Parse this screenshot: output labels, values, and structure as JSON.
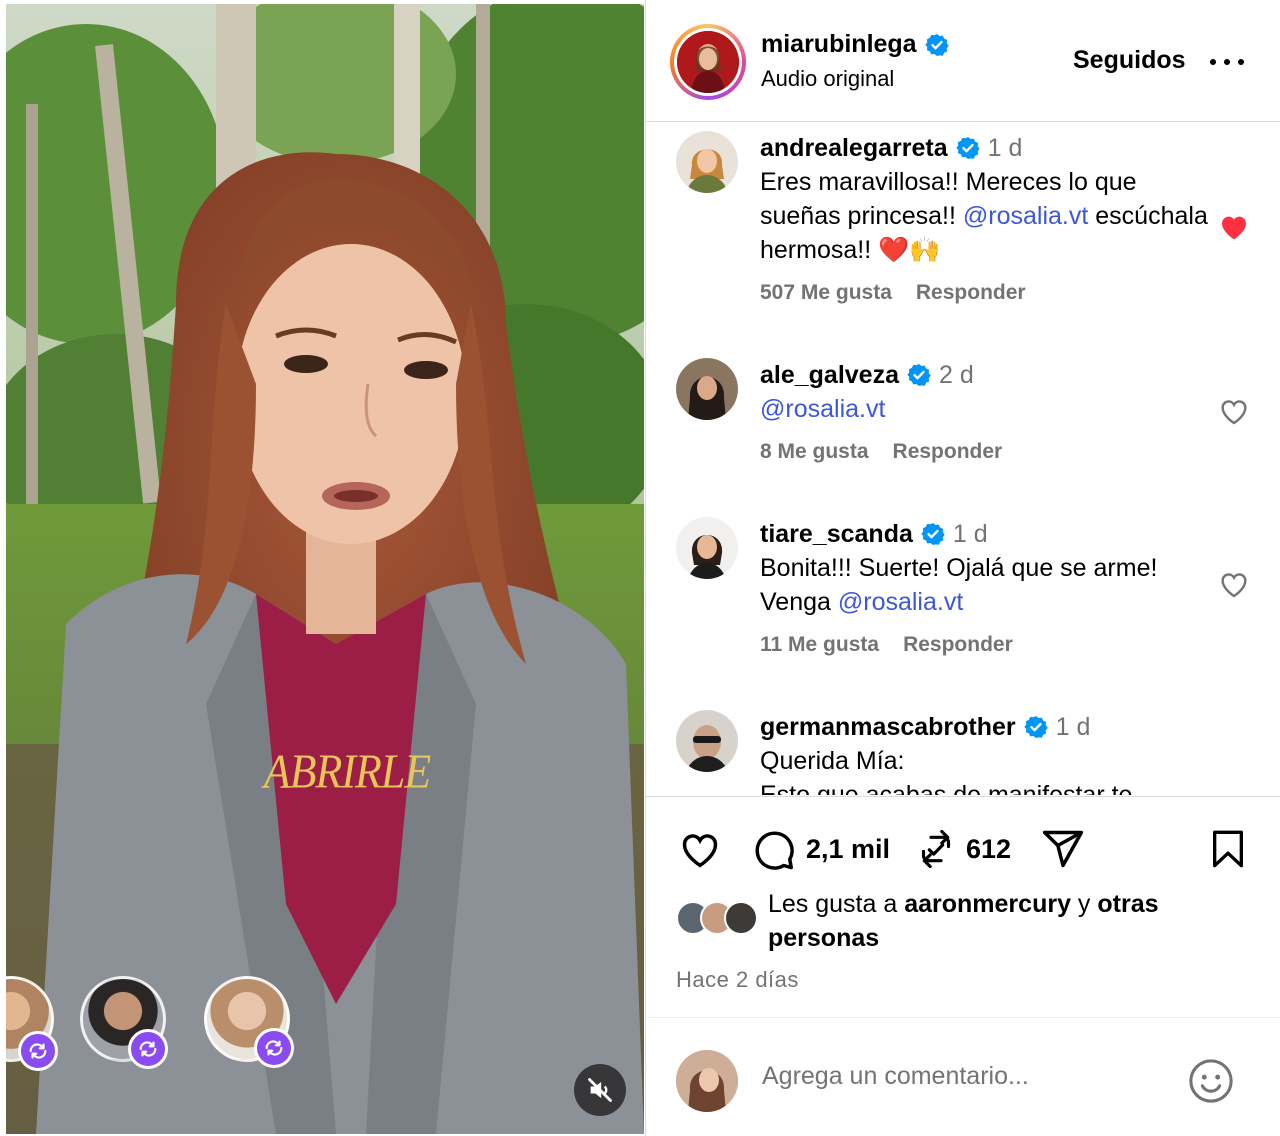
{
  "header": {
    "username": "miarubinlega",
    "subtitle": "Audio original",
    "follow_label": "Seguidos"
  },
  "media": {
    "overlay_text": "ABRIRLE",
    "muted": true
  },
  "comments": [
    {
      "username": "andrealegarreta",
      "verified": true,
      "time": "1 d",
      "text_parts": [
        "Eres maravillosa!! Mereces lo que sueñas princesa!! ",
        "@rosalia.vt",
        " escúchala hermosa!! ❤️🙌"
      ],
      "likes": "507 Me gusta",
      "reply": "Responder",
      "liked": true
    },
    {
      "username": "ale_galveza",
      "verified": true,
      "time": "2 d",
      "text_parts": [
        "",
        "@rosalia.vt",
        ""
      ],
      "likes": "8 Me gusta",
      "reply": "Responder",
      "liked": false
    },
    {
      "username": "tiare_scanda",
      "verified": true,
      "time": "1 d",
      "text_parts": [
        "Bonita!!! Suerte! Ojalá que se arme! Venga ",
        "@rosalia.vt",
        ""
      ],
      "likes": "11 Me gusta",
      "reply": "Responder",
      "liked": false
    },
    {
      "username": "germanmascabrother",
      "verified": true,
      "time": "1 d",
      "text_parts": [
        "Querida Mía:",
        "",
        ""
      ],
      "text_more": "Esto que acabas de manifestar te",
      "likes": "",
      "reply": "",
      "liked": false
    }
  ],
  "actions": {
    "comment_count": "2,1 mil",
    "repost_count": "612"
  },
  "likes": {
    "prefix": "Les gusta a ",
    "user": "aaronmercury",
    "middle": " y ",
    "suffix": "otras personas"
  },
  "time_ago": "Hace 2 días",
  "add_comment": {
    "placeholder": "Agrega un comentario..."
  },
  "colors": {
    "verified": "#0095f6",
    "mention": "#3d57d8",
    "heart_liked": "#ff3040",
    "secondary_text": "#737373",
    "collab_badge": "#8a4cf0"
  }
}
